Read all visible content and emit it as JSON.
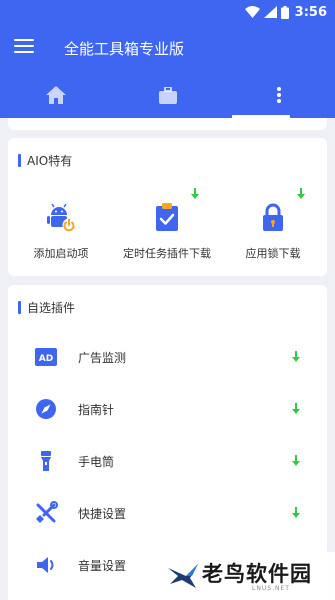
{
  "status_bar": {
    "time": "3:56",
    "icons": [
      "wifi-icon",
      "signal-icon",
      "battery-icon"
    ]
  },
  "app_bar": {
    "title": "全能工具箱专业版",
    "menu_icon": "menu-icon"
  },
  "tabs": [
    {
      "icon": "home-icon",
      "selected": false
    },
    {
      "icon": "briefcase-icon",
      "selected": false
    },
    {
      "icon": "more-vertical-icon",
      "selected": true
    }
  ],
  "aio_section": {
    "title": "AIO特有",
    "items": [
      {
        "label": "添加启动项",
        "icon": "android-autostart-icon",
        "downloadable": false
      },
      {
        "label": "定时任务插件下载",
        "icon": "scheduled-task-icon",
        "downloadable": true
      },
      {
        "label": "应用锁下载",
        "icon": "lock-icon",
        "downloadable": true
      }
    ]
  },
  "plugins_section": {
    "title": "自选插件",
    "items": [
      {
        "label": "广告监测",
        "icon": "ad-icon",
        "downloadable": true
      },
      {
        "label": "指南针",
        "icon": "compass-icon",
        "downloadable": true
      },
      {
        "label": "手电筒",
        "icon": "flashlight-icon",
        "downloadable": true
      },
      {
        "label": "快捷设置",
        "icon": "tools-icon",
        "downloadable": true
      },
      {
        "label": "音量设置",
        "icon": "volume-icon",
        "downloadable": false
      }
    ]
  },
  "watermark": {
    "text": "老鸟软件园",
    "sub": "LNUS.NET"
  },
  "colors": {
    "primary": "#3f66f0",
    "download_green": "#2ecc40",
    "background": "#eef0f6"
  }
}
